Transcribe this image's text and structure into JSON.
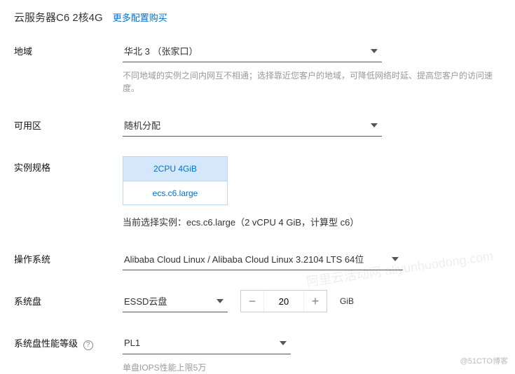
{
  "header": {
    "title": "云服务器C6 2核4G",
    "more_link": "更多配置购买"
  },
  "region": {
    "label": "地域",
    "value": "华北 3 （张家口）",
    "hint": "不同地域的实例之间内网互不相通；选择靠近您客户的地域，可降低网络时延、提高您客户的访问速度。"
  },
  "zone": {
    "label": "可用区",
    "value": "随机分配"
  },
  "spec": {
    "label": "实例规格",
    "cell_top": "2CPU 4GiB",
    "cell_bottom": "ecs.c6.large",
    "desc": "当前选择实例：ecs.c6.large（2 vCPU 4 GiB，计算型 c6）"
  },
  "os": {
    "label": "操作系统",
    "value": "Alibaba Cloud Linux / Alibaba Cloud Linux 3.2104 LTS 64位"
  },
  "sysdisk": {
    "label": "系统盘",
    "type": "ESSD云盘",
    "size": "20",
    "unit": "GiB"
  },
  "perf": {
    "label": "系统盘性能等级",
    "value": "PL1",
    "hint": "单盘IOPS性能上限5万"
  },
  "watermark": "阿里云活动网  aliyunhuodong.com",
  "watermark2": "@51CTO博客",
  "help": "?"
}
